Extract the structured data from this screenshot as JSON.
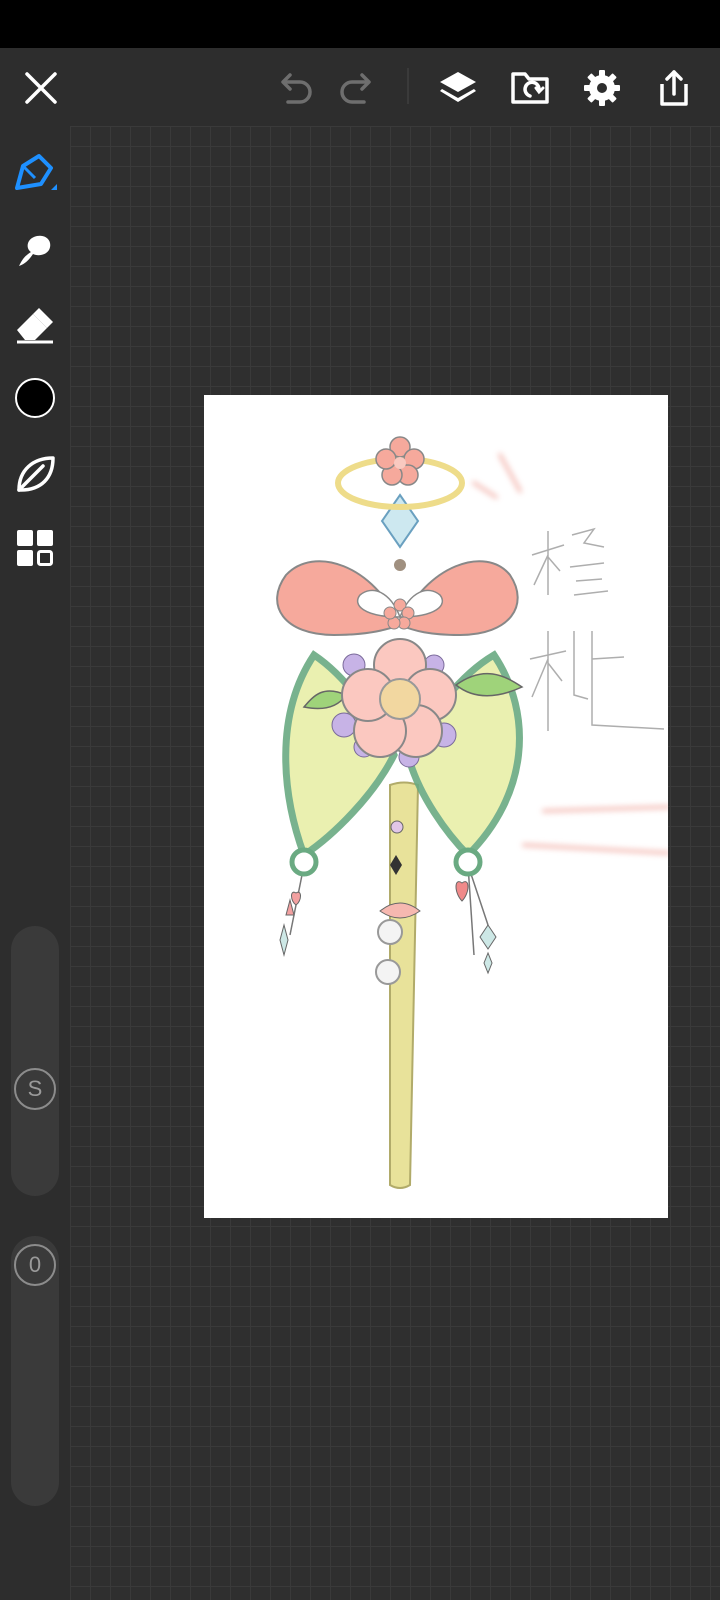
{
  "toolbar": {
    "close": "close-icon",
    "undo": "undo-icon",
    "redo": "redo-icon",
    "layers": "layers-icon",
    "import": "import-icon",
    "settings": "gear-icon",
    "share": "share-icon"
  },
  "tools": [
    "pencil-icon",
    "smudge-icon",
    "eraser-icon",
    "color-swatch",
    "leaf-icon",
    "grid-icon"
  ],
  "current_color": "#000000",
  "accent_color": "#1e90ff",
  "sliders": {
    "size_label": "S",
    "opacity_label": "0"
  }
}
